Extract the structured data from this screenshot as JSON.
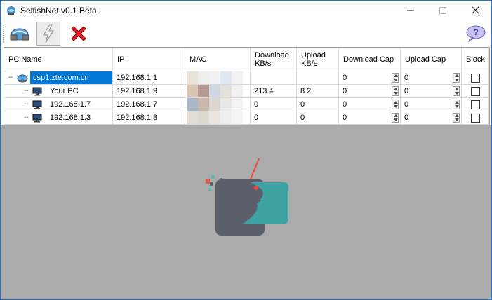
{
  "window": {
    "title": "SelfishNet v0.1 Beta"
  },
  "toolbar": {
    "buttons": [
      {
        "icon": "network-scan-icon"
      },
      {
        "icon": "lightning-icon"
      },
      {
        "icon": "red-x-icon"
      },
      {
        "icon": "help-speech-icon"
      }
    ]
  },
  "table": {
    "headers": [
      "PC Name",
      "IP",
      "MAC",
      "Download KB/s",
      "Upload KB/s",
      "Download Cap",
      "Upload Cap",
      "Block"
    ],
    "header_lines": {
      "download": [
        "Download",
        "KB/s"
      ],
      "upload": [
        "Upload",
        "KB/s"
      ]
    },
    "rows": [
      {
        "name": "csp1.zte.com.cn",
        "ip": "192.168.1.1",
        "download": "",
        "upload": "",
        "download_cap": "0",
        "upload_cap": "0",
        "block": false,
        "selected": true
      },
      {
        "name": "Your PC",
        "ip": "192.168.1.9",
        "download": "213.4",
        "upload": "8.2",
        "download_cap": "0",
        "upload_cap": "0",
        "block": false,
        "selected": false
      },
      {
        "name": "192.168.1.7",
        "ip": "192.168.1.7",
        "download": "0",
        "upload": "0",
        "download_cap": "0",
        "upload_cap": "0",
        "block": false,
        "selected": false
      },
      {
        "name": "192.168.1.3",
        "ip": "192.168.1.3",
        "download": "0",
        "upload": "0",
        "download_cap": "0",
        "upload_cap": "0",
        "block": false,
        "selected": false
      }
    ]
  },
  "colors": {
    "selection": "#0078d7",
    "background_area": "#ababab",
    "window_border": "#1e74d0"
  }
}
